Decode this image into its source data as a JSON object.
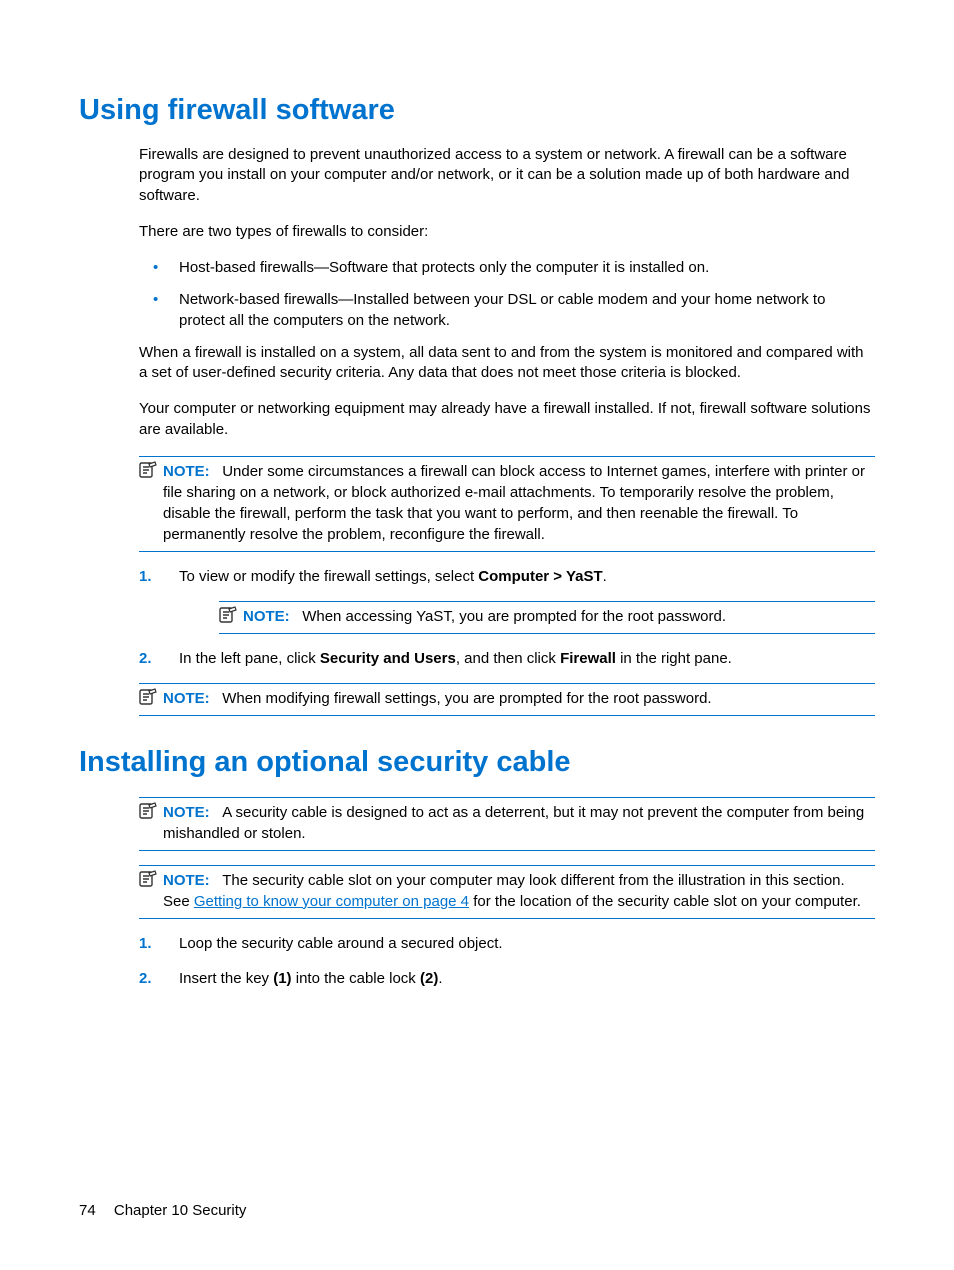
{
  "sections": [
    {
      "heading": "Using firewall software",
      "paragraphs": {
        "p1": "Firewalls are designed to prevent unauthorized access to a system or network. A firewall can be a software program you install on your computer and/or network, or it can be a solution made up of both hardware and software.",
        "p2": "There are two types of firewalls to consider:",
        "b1": "Host-based firewalls—Software that protects only the computer it is installed on.",
        "b2": "Network-based firewalls—Installed between your DSL or cable modem and your home network to protect all the computers on the network.",
        "p3": "When a firewall is installed on a system, all data sent to and from the system is monitored and compared with a set of user-defined security criteria. Any data that does not meet those criteria is blocked.",
        "p4": "Your computer or networking equipment may already have a firewall installed. If not, firewall software solutions are available.",
        "note1_label": "NOTE:",
        "note1": "Under some circumstances a firewall can block access to Internet games, interfere with printer or file sharing on a network, or block authorized e-mail attachments. To temporarily resolve the problem, disable the firewall, perform the task that you want to perform, and then reenable the firewall. To permanently resolve the problem, reconfigure the firewall.",
        "step1_num": "1.",
        "step1_pre": "To view or modify the firewall settings, select ",
        "step1_bold": "Computer > YaST",
        "step1_post": ".",
        "note2_label": "NOTE:",
        "note2": "When accessing YaST, you are prompted for the root password.",
        "step2_num": "2.",
        "step2_pre": "In the left pane, click ",
        "step2_bold1": "Security and Users",
        "step2_mid": ", and then click ",
        "step2_bold2": "Firewall",
        "step2_post": " in the right pane.",
        "note3_label": "NOTE:",
        "note3": "When modifying firewall settings, you are prompted for the root password."
      }
    },
    {
      "heading": "Installing an optional security cable",
      "paragraphs": {
        "noteA_label": "NOTE:",
        "noteA": "A security cable is designed to act as a deterrent, but it may not prevent the computer from being mishandled or stolen.",
        "noteB_label": "NOTE:",
        "noteB_pre": "The security cable slot on your computer may look different from the illustration in this section. See ",
        "noteB_link": "Getting to know your computer on page 4",
        "noteB_post": " for the location of the security cable slot on your computer.",
        "step1_num": "1.",
        "step1": "Loop the security cable around a secured object.",
        "step2_num": "2.",
        "step2_pre": "Insert the key ",
        "step2_b1": "(1)",
        "step2_mid": " into the cable lock ",
        "step2_b2": "(2)",
        "step2_post": "."
      }
    }
  ],
  "footer": {
    "page_num": "74",
    "chapter": "Chapter 10   Security"
  }
}
